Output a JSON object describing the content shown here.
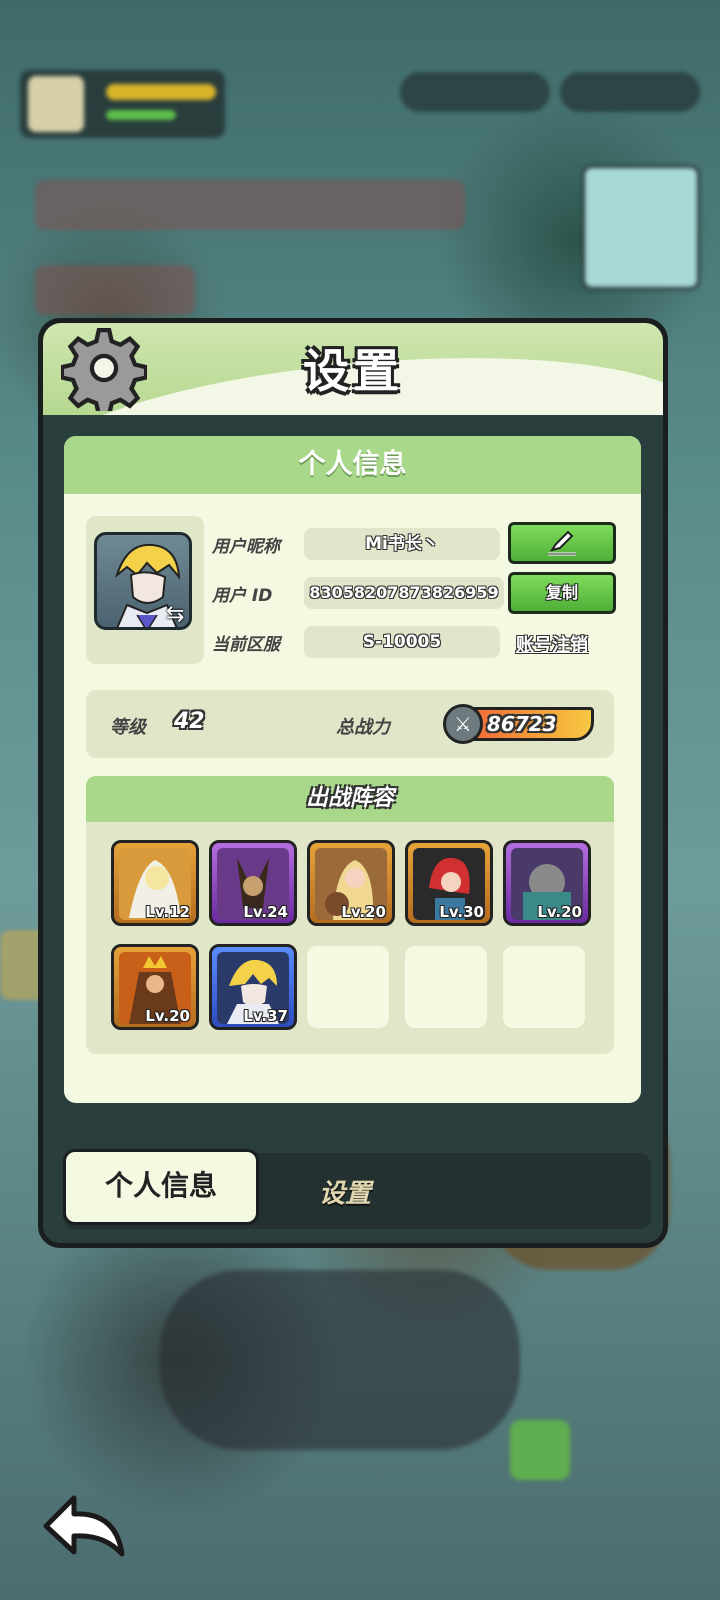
{
  "dialog": {
    "title": "设置"
  },
  "panel": {
    "title": "个人信息",
    "nickname_label": "用户昵称",
    "nickname_value": "Mi书长丶",
    "id_label": "用户  ID",
    "id_value": "83058207873826959",
    "server_label": "当前区服",
    "server_value": "S-10005",
    "copy_button": "复制",
    "logout_link": "账号注销",
    "level_label": "等级",
    "level_value": "42",
    "power_label": "总战力",
    "power_value": "86723",
    "lineup_title": "出战阵容"
  },
  "lineup": [
    {
      "level": "Lv.12",
      "rarity": "gold"
    },
    {
      "level": "Lv.24",
      "rarity": "purple"
    },
    {
      "level": "Lv.20",
      "rarity": "gold"
    },
    {
      "level": "Lv.30",
      "rarity": "gold"
    },
    {
      "level": "Lv.20",
      "rarity": "purple"
    },
    {
      "level": "Lv.20",
      "rarity": "gold"
    },
    {
      "level": "Lv.37",
      "rarity": "blue"
    }
  ],
  "tabs": {
    "active": "个人信息",
    "inactive": "设置"
  },
  "colors": {
    "accent_green": "#4fae38",
    "panel_bg": "#f4f9e2",
    "header_green": "#a9d88a"
  }
}
